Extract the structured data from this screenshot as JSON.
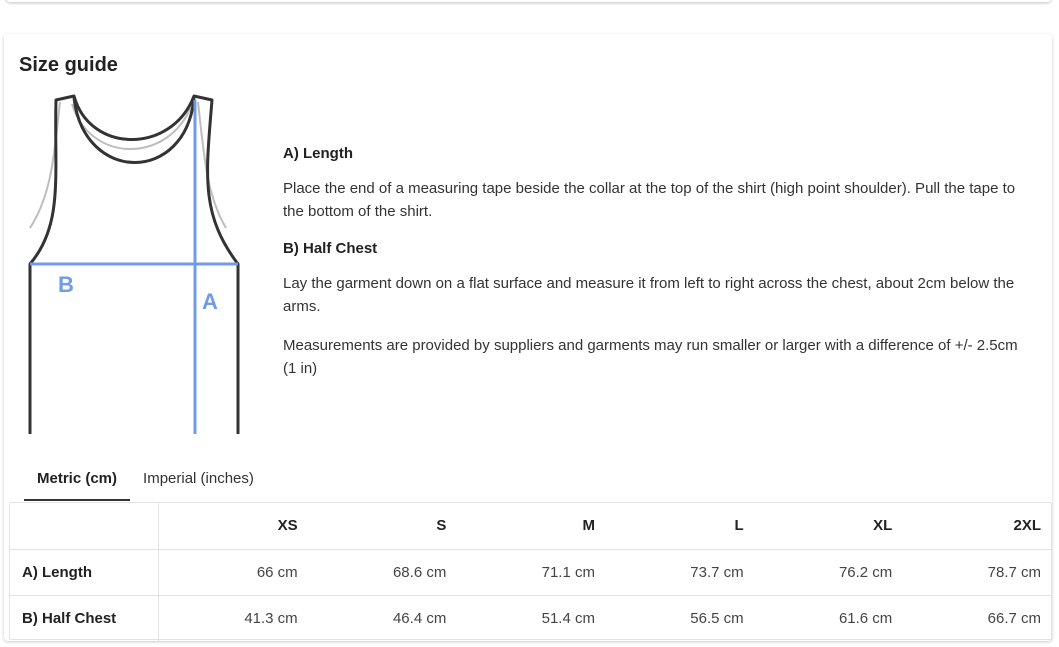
{
  "title": "Size guide",
  "diagram": {
    "label_a": "A",
    "label_b": "B",
    "accent_color": "#6f9be8",
    "icon": "tank-top-icon"
  },
  "description": {
    "length_heading": "A) Length",
    "length_text": "Place the end of a measuring tape beside the collar at the top of the shirt (high point shoulder). Pull the tape to the bottom of the shirt.",
    "chest_heading": "B) Half Chest",
    "chest_text": "Lay the garment down on a flat surface and measure it from left to right across the chest, about 2cm below the arms.",
    "note": "Measurements are provided by suppliers and garments may run smaller or larger with a difference of +/- 2.5cm (1 in)"
  },
  "tabs": [
    {
      "label": "Metric (cm)",
      "active": true
    },
    {
      "label": "Imperial (inches)",
      "active": false
    }
  ],
  "table": {
    "sizes": [
      "XS",
      "S",
      "M",
      "L",
      "XL",
      "2XL"
    ],
    "rows": [
      {
        "label": "A) Length",
        "values": [
          "66 cm",
          "68.6 cm",
          "71.1 cm",
          "73.7 cm",
          "76.2 cm",
          "78.7 cm"
        ]
      },
      {
        "label": "B) Half Chest",
        "values": [
          "41.3 cm",
          "46.4 cm",
          "51.4 cm",
          "56.5 cm",
          "61.6 cm",
          "66.7 cm"
        ]
      }
    ]
  }
}
